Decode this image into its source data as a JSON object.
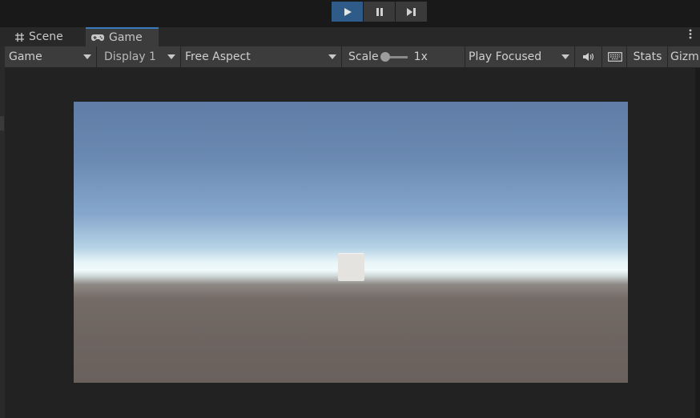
{
  "play_controls": {
    "play": "play-icon",
    "pause": "pause-icon",
    "step": "step-icon",
    "active_color": "#2f5b88"
  },
  "tabs": {
    "scene_label": "Scene",
    "game_label": "Game",
    "menu_icon": "kebab-icon"
  },
  "toolbar": {
    "game_dropdown": "Game",
    "display_dropdown": "Display 1",
    "aspect_dropdown": "Free Aspect",
    "scale_label": "Scale",
    "scale_value": "1x",
    "scale_slider_level": 0,
    "play_mode_dropdown": "Play Focused",
    "audio_icon": "speaker-icon",
    "keyboard_icon": "keyboard-icon",
    "stats_label": "Stats",
    "gizmos_label": "Gizm"
  },
  "game_view": {
    "sky_top_color": "#5f7da6",
    "horizon_color": "#f1fafb",
    "ground_color": "#6d6460",
    "object": "cube"
  }
}
